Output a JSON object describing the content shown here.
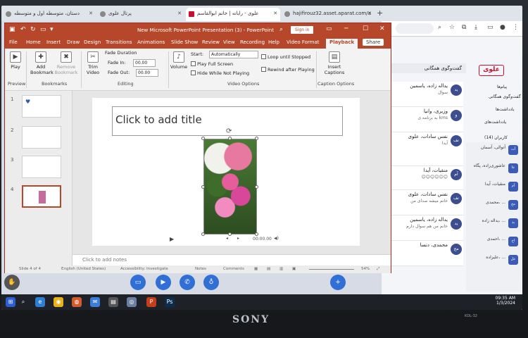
{
  "browser": {
    "tabs": [
      {
        "label": "دستان، متوسطه اول و متوسطه",
        "active": false
      },
      {
        "label": "پرتال علوی",
        "active": false
      },
      {
        "label": "علوی - رایانه | خانم ابوالقاسم",
        "active": true
      },
      {
        "label": "hajifirouz32.asset.aparat.com/a",
        "active": false
      }
    ],
    "new_tab": "+"
  },
  "ppt": {
    "title": "New Microsoft PowerPoint Presentation (3)  -  PowerPoint",
    "sign_in": "Sign in",
    "share": "Share",
    "ribbon_tabs": [
      "File",
      "Home",
      "Insert",
      "Draw",
      "Design",
      "Transitions",
      "Animations",
      "Slide Show",
      "Review",
      "View",
      "Recording",
      "Help",
      "Video Format",
      "Playback"
    ],
    "active_tab": "Playback",
    "groups": {
      "preview": "Preview",
      "bookmarks": "Bookmarks",
      "editing": "Editing",
      "video_options": "Video Options",
      "caption_options": "Caption Options"
    },
    "buttons": {
      "play": "Play",
      "add_bookmark": "Add Bookmark",
      "remove_bookmark": "Remove Bookmark",
      "trim_video": "Trim Video",
      "volume": "Volume",
      "insert_captions": "Insert Captions"
    },
    "fade": {
      "label": "Fade Duration",
      "fade_in_label": "Fade In:",
      "fade_in_value": "00.00",
      "fade_out_label": "Fade Out:",
      "fade_out_value": "00.00"
    },
    "start": {
      "label": "Start:",
      "value": "Automatically"
    },
    "checks": {
      "play_full_screen": "Play Full Screen",
      "hide_while_not_playing": "Hide While Not Playing",
      "loop_until_stopped": "Loop until Stopped",
      "rewind_after_playing": "Rewind after Playing"
    },
    "slide_numbers": [
      "1",
      "2",
      "3",
      "4"
    ],
    "slide_title_placeholder": "Click to add title",
    "media_time": "00:00.00",
    "notes_placeholder": "Click to add notes",
    "status": {
      "slide": "Slide 4 of 4",
      "language": "English (United States)",
      "accessibility": "Accessibility: Investigate",
      "notes": "Notes",
      "comments": "Comments",
      "zoom": "54%"
    }
  },
  "chat": {
    "header": "گفت‌وگوی همگانی",
    "brand": "علوی",
    "messages": [
      {
        "name": "یداله زاده، یاسمین",
        "text": "سوال",
        "avatar": "ید"
      },
      {
        "name": "وزیری، وانیا",
        "text": "به برنامه ی kms",
        "avatar": "و"
      },
      {
        "name": "نفس سادات، علوی",
        "text": "آیدا",
        "avatar": "نف"
      },
      {
        "name": "منقیات، آیدا",
        "text": "😊😊😊😊😊😊",
        "avatar": "آم"
      },
      {
        "name": "نفس سادات، علوی",
        "text": "خانم میشه صدای من",
        "avatar": "نف"
      },
      {
        "name": "یداله زاده، یاسمین",
        "text": "خانم من هم سوال دارم",
        "avatar": "ید"
      },
      {
        "name": "محمدی، دنسا",
        "text": "",
        "avatar": "مح"
      }
    ],
    "side_labels": [
      "پیام‌ها",
      "گفت‌وگوی همگانی",
      "یادداشت‌ها",
      "یادداشت‌های",
      "کاربران (14)"
    ],
    "users": [
      {
        "name": "آتوالی، آسمان",
        "avatar": "آت"
      },
      {
        "name": "عاشوری‌زاده، پگاه",
        "avatar": "عا"
      },
      {
        "name": "منقیات، آیدا",
        "avatar": "آم"
      },
      {
        "name": "محمدی، ...",
        "avatar": "مح"
      },
      {
        "name": "یداله زاده، ...",
        "avatar": "ید"
      },
      {
        "name": "احمدی، ...",
        "avatar": "اح"
      },
      {
        "name": "علیزاده، ...",
        "avatar": "عل"
      }
    ],
    "clock_time": "09:35 AM",
    "clock_date": "1/3/2024"
  },
  "monitor": {
    "brand": "SONY",
    "model": "KDL-32"
  },
  "colors": {
    "ppt_accent": "#b7472a",
    "meeting_blue": "#2f6fd6",
    "brand_red": "#c8102e"
  }
}
